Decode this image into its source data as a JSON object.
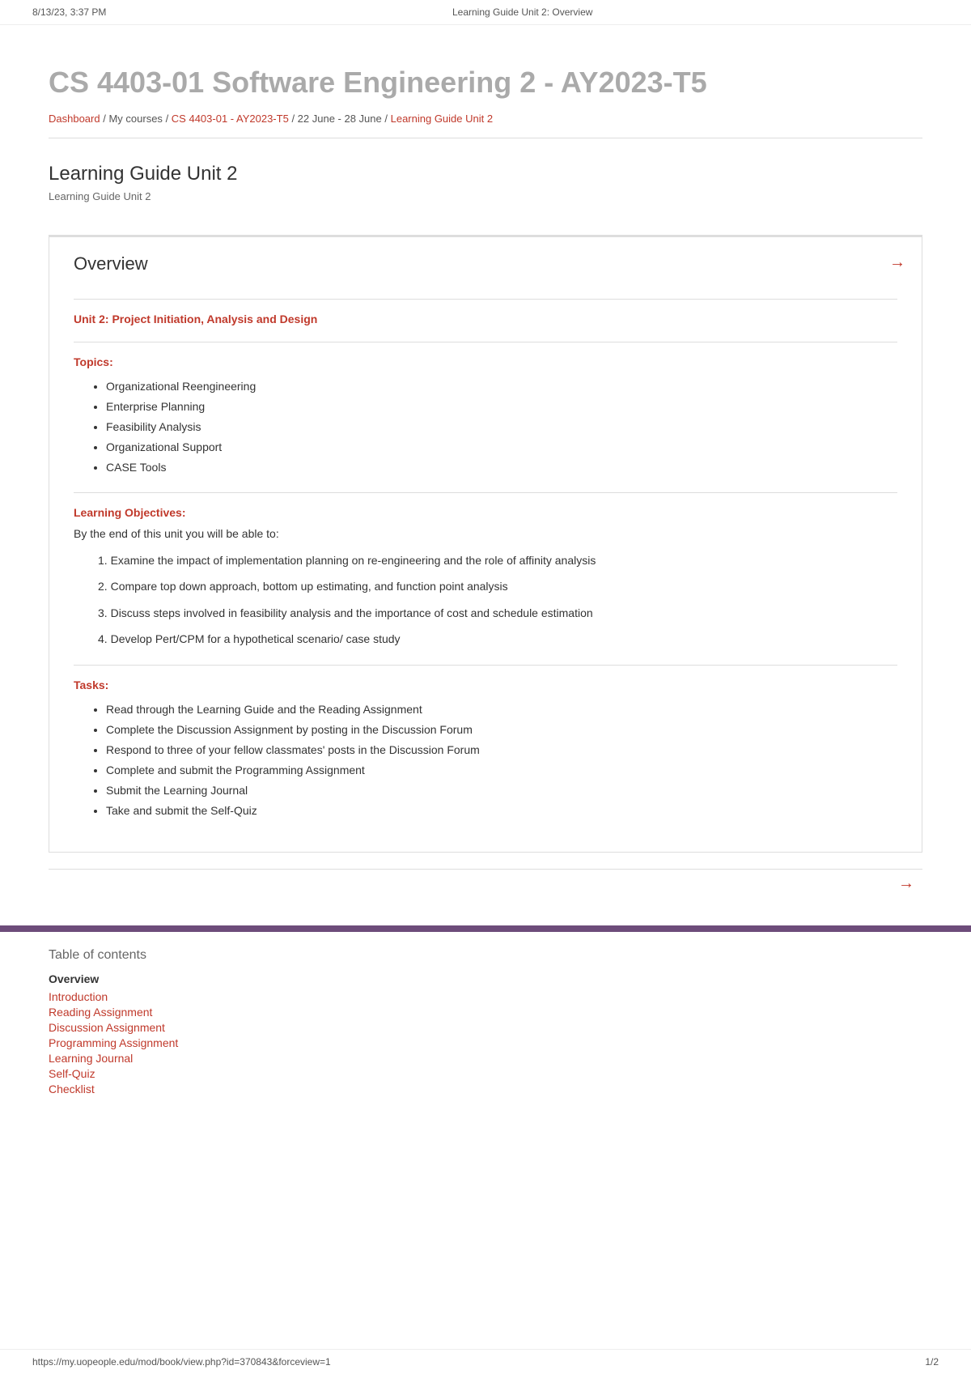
{
  "meta": {
    "date": "8/13/23, 3:37 PM",
    "page_title": "Learning Guide Unit 2: Overview"
  },
  "breadcrumb": {
    "dashboard": "Dashboard",
    "separator1": " / ",
    "my_courses": "My courses",
    "separator2": " / ",
    "course_link": "CS 4403-01 - AY2023-T5",
    "separator3": " / ",
    "date_range": "22 June - 28 June",
    "separator4": " / ",
    "current": "Learning Guide Unit 2"
  },
  "page": {
    "main_title": "CS 4403-01 Software Engineering 2 - AY2023-T5",
    "section_title": "Learning Guide Unit 2",
    "section_subtitle": "Learning Guide Unit 2"
  },
  "overview": {
    "title": "Overview",
    "unit_heading": "Unit 2: Project Initiation, Analysis and Design",
    "topics_heading": "Topics:",
    "topics": [
      "Organizational Reengineering",
      "Enterprise Planning",
      "Feasibility Analysis",
      "Organizational Support",
      "CASE Tools"
    ],
    "learning_objectives_heading": "Learning Objectives:",
    "learning_objectives_intro": "By the end of this unit you will be able to:",
    "objectives": [
      "Examine the impact of implementation planning on re-engineering and the role of affinity analysis",
      "Compare top down approach,  bottom up estimating, and function point analysis",
      "Discuss  steps involved in feasibility analysis and the importance of cost and schedule estimation",
      "Develop Pert/CPM  for a hypothetical scenario/ case study"
    ],
    "tasks_heading": "Tasks:",
    "tasks": [
      "Read through the Learning Guide and the Reading Assignment",
      "Complete the Discussion Assignment by posting in the Discussion Forum",
      "Respond to three of your fellow classmates' posts in the Discussion Forum",
      "Complete and submit the  Programming  Assignment",
      "Submit the Learning Journal",
      "Take and submit the Self-Quiz"
    ]
  },
  "toc": {
    "title": "Table of contents",
    "current_label": "Overview",
    "items": [
      {
        "label": "Introduction",
        "href": "#"
      },
      {
        "label": "Reading Assignment",
        "href": "#"
      },
      {
        "label": "Discussion Assignment",
        "href": "#"
      },
      {
        "label": "Programming Assignment",
        "href": "#"
      },
      {
        "label": "Learning Journal",
        "href": "#"
      },
      {
        "label": "Self-Quiz",
        "href": "#"
      },
      {
        "label": "Checklist",
        "href": "#"
      }
    ]
  },
  "footer": {
    "url": "https://my.uopeople.edu/mod/book/view.php?id=370843&forceview=1",
    "page_num": "1/2"
  },
  "nav": {
    "arrow_right": "→"
  }
}
